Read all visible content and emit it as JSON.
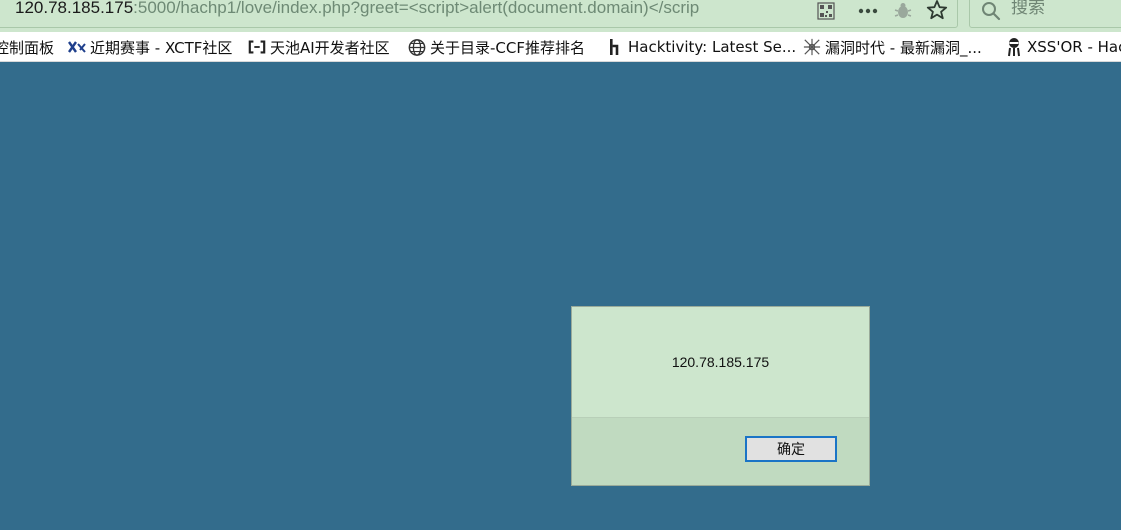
{
  "address_bar": {
    "host": "120.78.185.175",
    "path": ":5000/hachp1/love/index.php?greet=<script>alert(document.domain)</scrip"
  },
  "search": {
    "placeholder": "搜索"
  },
  "bookmarks": [
    {
      "label": "控制面板",
      "icon": "folder-icon"
    },
    {
      "label": "近期赛事 - XCTF社区",
      "icon": "xctf-logo-icon"
    },
    {
      "label": "天池AI开发者社区",
      "icon": "aliyun-logo-icon"
    },
    {
      "label": "关于目录-CCF推荐排名",
      "icon": "globe-icon"
    },
    {
      "label": "Hacktivity: Latest Se...",
      "icon": "hackerone-logo-icon"
    },
    {
      "label": "漏洞时代 - 最新漏洞_...",
      "icon": "vulnerability-site-icon"
    },
    {
      "label": "XSS'OR - Hac",
      "icon": "xssor-logo-icon"
    }
  ],
  "alert": {
    "message": "120.78.185.175",
    "ok_label": "确定"
  },
  "colors": {
    "page_background": "#336c8c",
    "toolbar_background": "#cde6cd",
    "dialog_background": "#cde6cd",
    "dialog_footer": "#c0dac0",
    "button_border": "#1a74c6"
  }
}
